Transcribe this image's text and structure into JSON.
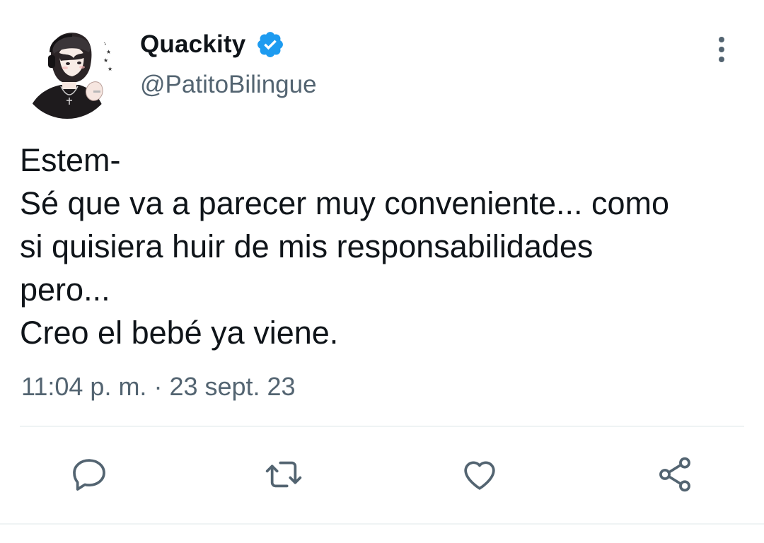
{
  "tweet": {
    "author": {
      "display_name": "Quackity",
      "handle": "@PatitoBilingue",
      "verified": true,
      "verified_color": "#1d9bf0"
    },
    "text_lines": [
      "Estem-",
      "Sé que va a parecer muy conveniente... como",
      "si quisiera huir de mis responsabilidades",
      "pero...",
      "Creo el bebé ya viene."
    ],
    "time": "11:04 p. m.",
    "separator": "·",
    "date": "23 sept. 23"
  },
  "icons": {
    "more": "more-vertical-icon",
    "verified": "verified-badge-icon",
    "reply": "reply-icon",
    "retweet": "retweet-icon",
    "like": "like-icon",
    "share": "share-icon"
  },
  "colors": {
    "text_primary": "#0f1419",
    "text_secondary": "#536471",
    "icon_color": "#536471",
    "divider": "#eff3f4"
  }
}
